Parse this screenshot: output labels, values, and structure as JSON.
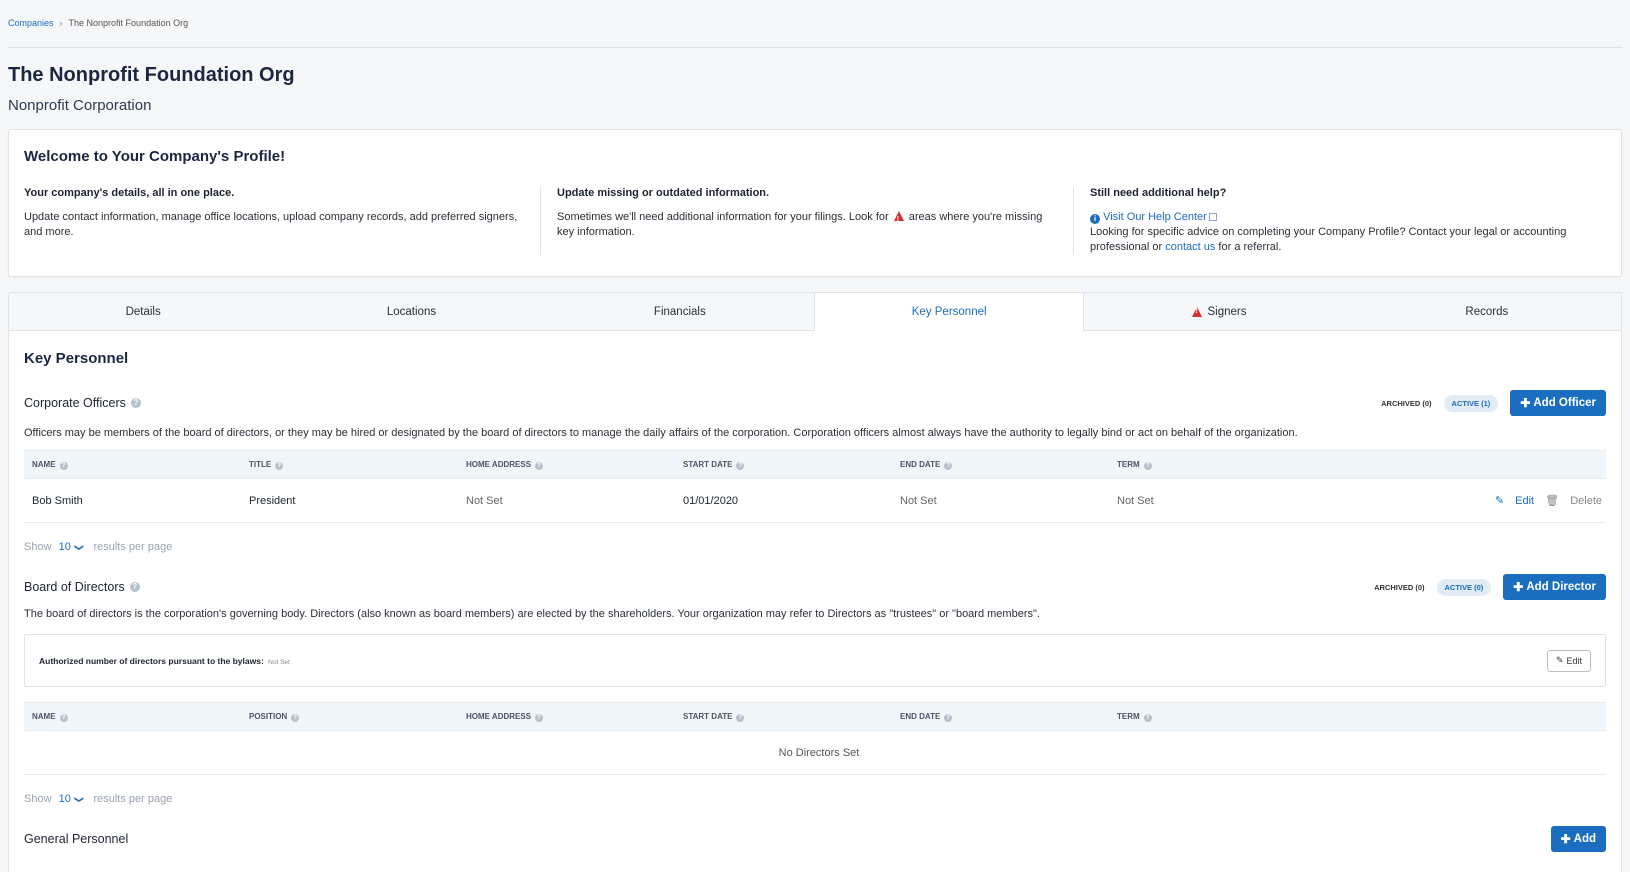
{
  "breadcrumb": {
    "root": "Companies",
    "current": "The Nonprofit Foundation Org"
  },
  "company": {
    "name": "The Nonprofit Foundation Org",
    "type": "Nonprofit Corporation"
  },
  "welcome": {
    "title": "Welcome to Your Company's Profile!",
    "col1": {
      "heading": "Your company's details, all in one place.",
      "text": "Update contact information, manage office locations, upload company records, add preferred signers, and more."
    },
    "col2": {
      "heading": "Update missing or outdated information.",
      "text_before": "Sometimes we'll need additional information for your filings. Look for",
      "text_after": "areas where you're missing key information."
    },
    "col3": {
      "heading": "Still need additional help?",
      "help_link": "Visit Our Help Center",
      "text_before": "Looking for specific advice on completing your Company Profile? Contact your legal or accounting professional or",
      "contact_link": "contact us",
      "text_after": "for a referral."
    }
  },
  "tabs": [
    "Details",
    "Locations",
    "Financials",
    "Key Personnel",
    "Signers",
    "Records"
  ],
  "key_personnel": {
    "title": "Key Personnel",
    "officers": {
      "title": "Corporate Officers",
      "archived": "ARCHIVED (0)",
      "active": "ACTIVE (1)",
      "add_button": "Add Officer",
      "description": "Officers may be members of the board of directors, or they may be hired or designated by the board of directors to manage the daily affairs of the corporation. Corporation officers almost always have the authority to legally bind or act on behalf of the organization.",
      "columns": [
        "NAME",
        "TITLE",
        "HOME ADDRESS",
        "START DATE",
        "END DATE",
        "TERM"
      ],
      "rows": [
        {
          "name": "Bob Smith",
          "title": "President",
          "address": "Not Set",
          "start": "01/01/2020",
          "end": "Not Set",
          "term": "Not Set",
          "edit": "Edit",
          "delete": "Delete"
        }
      ],
      "show": {
        "label": "Show",
        "count": "10",
        "suffix": "results per page"
      }
    },
    "directors": {
      "title": "Board of Directors",
      "archived": "ARCHIVED (0)",
      "active": "ACTIVE (0)",
      "add_button": "Add Director",
      "description": "The board of directors is the corporation's governing body. Directors (also known as board members) are elected by the shareholders. Your organization may refer to Directors as \"trustees\" or \"board members\".",
      "authorized_label": "Authorized number of directors pursuant to the bylaws:",
      "authorized_value": "Not Set",
      "edit_button": "Edit",
      "columns": [
        "NAME",
        "POSITION",
        "HOME ADDRESS",
        "START DATE",
        "END DATE",
        "TERM"
      ],
      "empty": "No Directors Set",
      "show": {
        "label": "Show",
        "count": "10",
        "suffix": "results per page"
      }
    },
    "general": {
      "title": "General Personnel",
      "add_button": "Add"
    }
  }
}
